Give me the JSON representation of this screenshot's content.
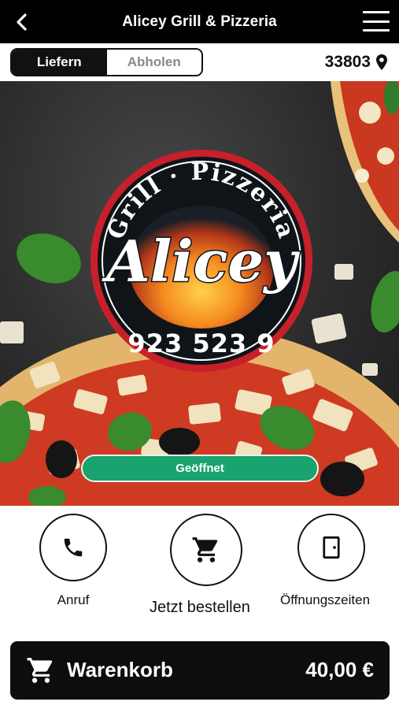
{
  "header": {
    "title": "Alicey Grill & Pizzeria",
    "back_icon": "chevron-left-icon",
    "menu_icon": "hamburger-menu-icon"
  },
  "mode_toggle": {
    "options": [
      "Liefern",
      "Abholen"
    ],
    "selected": "Liefern"
  },
  "location": {
    "postal_code": "33803",
    "icon": "map-pin-icon"
  },
  "hero": {
    "logo": {
      "top_text": "Grill · Pizzeria",
      "brand": "Alicey",
      "phone": "923 523 9"
    },
    "status": "Geöffnet"
  },
  "actions": [
    {
      "label": "Anruf",
      "icon": "phone-icon"
    },
    {
      "label": "Jetzt bestellen",
      "icon": "shopping-cart-icon"
    },
    {
      "label": "Öffnungszeiten",
      "icon": "door-icon"
    }
  ],
  "cart": {
    "label": "Warenkorb",
    "total": "40,00 €",
    "icon": "shopping-cart-icon"
  },
  "colors": {
    "header_bg": "#000000",
    "status_green": "#1aa36f",
    "logo_ring": "#c8202a",
    "cart_bg": "#0d0d0d"
  }
}
